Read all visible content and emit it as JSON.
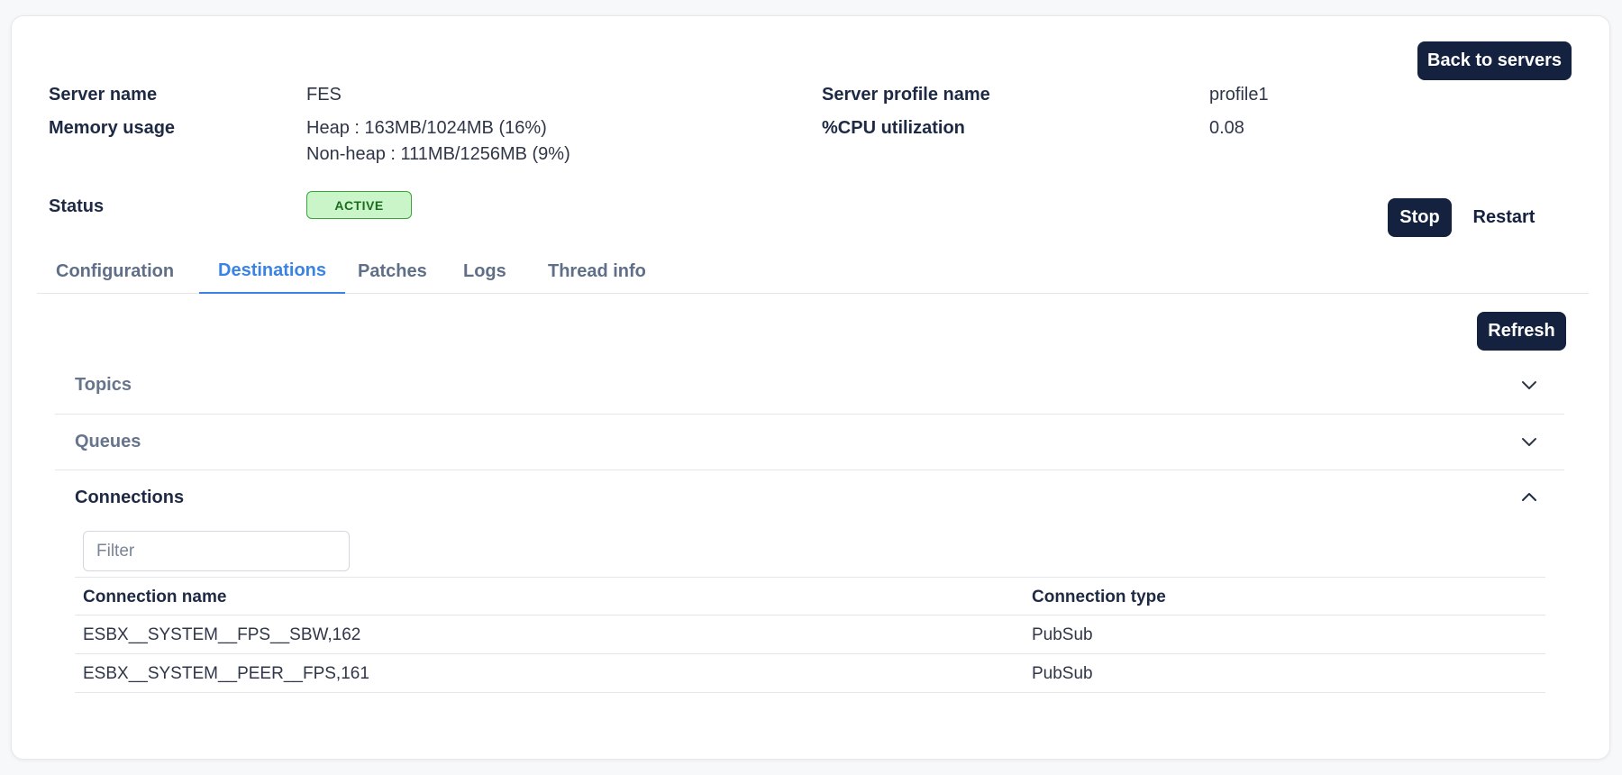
{
  "header": {
    "back_button": "Back to servers",
    "server_name_label": "Server name",
    "server_name_value": "FES",
    "memory_label": "Memory usage",
    "memory_heap": "Heap : 163MB/1024MB (16%)",
    "memory_nonheap": "Non-heap : 111MB/1256MB (9%)",
    "profile_label": "Server profile name",
    "profile_value": "profile1",
    "cpu_label": "%CPU utilization",
    "cpu_value": "0.08",
    "status_label": "Status",
    "status_value": "ACTIVE",
    "stop_button": "Stop",
    "restart_button": "Restart"
  },
  "tabs": [
    {
      "label": "Configuration"
    },
    {
      "label": "Destinations"
    },
    {
      "label": "Patches"
    },
    {
      "label": "Logs"
    },
    {
      "label": "Thread info"
    }
  ],
  "active_tab": "Destinations",
  "destinations": {
    "refresh_button": "Refresh",
    "sections": [
      {
        "label": "Topics",
        "expanded": false
      },
      {
        "label": "Queues",
        "expanded": false
      },
      {
        "label": "Connections",
        "expanded": true
      }
    ],
    "filter_placeholder": "Filter",
    "table": {
      "columns": [
        "Connection name",
        "Connection type"
      ],
      "rows": [
        [
          "ESBX__SYSTEM__FPS__SBW,162",
          "PubSub"
        ],
        [
          "ESBX__SYSTEM__PEER__FPS,161",
          "PubSub"
        ]
      ]
    }
  },
  "colors": {
    "primary_button": "#14223f",
    "active_tab": "#3a83e6",
    "status_active_bg": "#c9f5c9",
    "status_active_text": "#1d6b1d"
  }
}
